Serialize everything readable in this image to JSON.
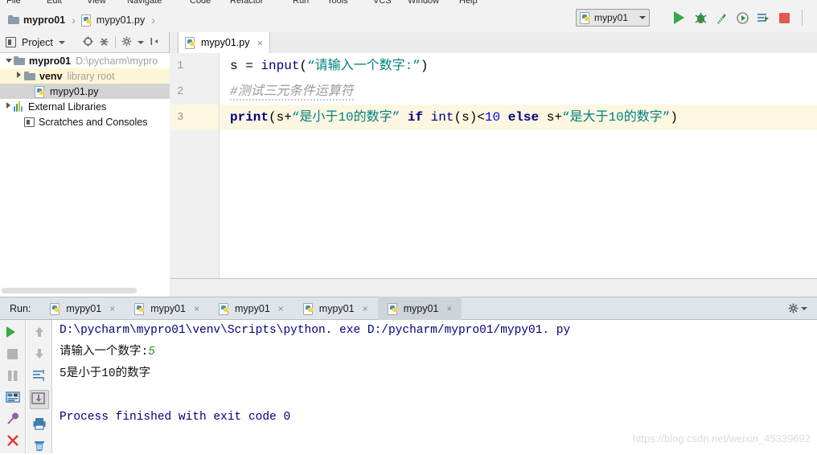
{
  "menubar": {
    "items": [
      "File",
      "Edit",
      "View",
      "Navigate",
      "Code",
      "Refactor",
      "Run",
      "Tools",
      "VCS",
      "Window",
      "Help"
    ]
  },
  "navbar": {
    "breadcrumbs": [
      {
        "label": "mypro01",
        "icon": "folder-icon",
        "bold": true
      },
      {
        "label": "mypy01.py",
        "icon": "python-file-icon",
        "bold": false
      }
    ],
    "separator": "›",
    "run_config": {
      "label": "mypy01",
      "icon": "python-config-icon"
    },
    "toolbar_icons": [
      {
        "name": "run-icon",
        "title": "Run"
      },
      {
        "name": "debug-icon",
        "title": "Debug"
      },
      {
        "name": "run-coverage-icon",
        "title": "Run with Coverage"
      },
      {
        "name": "profile-icon",
        "title": "Profile"
      },
      {
        "name": "run-with-console-icon",
        "title": "Run with Console"
      },
      {
        "name": "stop-icon",
        "title": "Stop"
      }
    ]
  },
  "project_panel": {
    "title": "Project",
    "toolbar_icons": [
      {
        "name": "locate-target-icon"
      },
      {
        "name": "collapse-all-icon"
      },
      {
        "name": "settings-gear-icon"
      },
      {
        "name": "hide-panel-icon"
      }
    ],
    "tree": [
      {
        "label": "mypro01",
        "detail": "D:\\pycharm\\mypro",
        "icon": "folder-icon",
        "expanded": true,
        "indent": 0,
        "bold": true,
        "selected": false
      },
      {
        "label": "venv",
        "detail": "library root",
        "icon": "folder-icon",
        "expanded": false,
        "indent": 1,
        "bold": true,
        "selected": "yellow"
      },
      {
        "label": "mypy01.py",
        "detail": "",
        "icon": "python-file-icon",
        "expanded": null,
        "indent": 2,
        "bold": false,
        "selected": "gray"
      },
      {
        "label": "External Libraries",
        "detail": "",
        "icon": "library-icon",
        "expanded": false,
        "indent": 0,
        "bold": false,
        "selected": false
      },
      {
        "label": "Scratches and Consoles",
        "detail": "",
        "icon": "scratches-icon",
        "expanded": null,
        "indent": 1,
        "bold": false,
        "selected": false
      }
    ]
  },
  "editor": {
    "tab": {
      "label": "mypy01.py",
      "icon": "python-file-icon",
      "close": "×"
    },
    "line_numbers": [
      "1",
      "2",
      "3"
    ],
    "highlighted_line": 3,
    "lines": [
      {
        "n": 1,
        "tokens": [
          {
            "t": "s = ",
            "c": "plain"
          },
          {
            "t": "input",
            "c": "fn"
          },
          {
            "t": "(",
            "c": "plain"
          },
          {
            "t": "“请输入一个数字:”",
            "c": "str"
          },
          {
            "t": ")",
            "c": "plain"
          }
        ]
      },
      {
        "n": 2,
        "tokens": [
          {
            "t": "#测试三元条件运算符",
            "c": "cmt"
          }
        ]
      },
      {
        "n": 3,
        "tokens": [
          {
            "t": "print",
            "c": "def"
          },
          {
            "t": "(s+",
            "c": "plain"
          },
          {
            "t": "“是小于10的数字”",
            "c": "str"
          },
          {
            "t": " ",
            "c": "plain"
          },
          {
            "t": "if",
            "c": "def"
          },
          {
            "t": " ",
            "c": "plain"
          },
          {
            "t": "int",
            "c": "fn"
          },
          {
            "t": "(s)<",
            "c": "plain"
          },
          {
            "t": "10",
            "c": "num"
          },
          {
            "t": " ",
            "c": "plain"
          },
          {
            "t": "else",
            "c": "def"
          },
          {
            "t": " s+",
            "c": "plain"
          },
          {
            "t": "“是大于10的数字”",
            "c": "str"
          },
          {
            "t": ")",
            "c": "plain"
          }
        ]
      }
    ]
  },
  "run_panel": {
    "label": "Run:",
    "tabs": [
      {
        "label": "mypy01",
        "active": false
      },
      {
        "label": "mypy01",
        "active": false
      },
      {
        "label": "mypy01",
        "active": false
      },
      {
        "label": "mypy01",
        "active": false
      },
      {
        "label": "mypy01",
        "active": true
      }
    ],
    "close_glyph": "×",
    "settings_icon": "gear-icon",
    "toolbar_col1": [
      {
        "name": "rerun-icon"
      },
      {
        "name": "stop-icon"
      },
      {
        "name": "pause-icon"
      },
      {
        "name": "console-view-icon"
      },
      {
        "name": "pin-tab-icon"
      },
      {
        "name": "close-icon"
      }
    ],
    "toolbar_col2": [
      {
        "name": "up-arrow-icon"
      },
      {
        "name": "down-arrow-icon"
      },
      {
        "name": "soft-wrap-icon"
      },
      {
        "name": "scroll-to-end-icon"
      },
      {
        "name": "print-icon"
      },
      {
        "name": "trash-icon"
      }
    ],
    "console_lines": [
      {
        "type": "command",
        "text": "D:\\pycharm\\mypro01\\venv\\Scripts\\python. exe D:/pycharm/mypro01/mypy01. py"
      },
      {
        "type": "prompt_input",
        "prompt": "请输入一个数字:",
        "input": "5"
      },
      {
        "type": "output",
        "text": "5是小于10的数字"
      },
      {
        "type": "blank",
        "text": ""
      },
      {
        "type": "finished",
        "text": "Process finished with exit code 0"
      }
    ]
  },
  "watermark": "https://blog.csdn.net/weixin_45339692",
  "colors": {
    "accent_green": "#39a845",
    "string_teal": "#008080",
    "keyword_navy": "#000080",
    "comment_gray": "#9a9a9a",
    "number_blue": "#0000ff",
    "highlight_line": "#fdf7e2",
    "panel_bg": "#f2f2f2",
    "runtab_bg": "#dfe3ea",
    "selection_gray": "#d4d4d4",
    "selection_yellow": "#fdf6d6"
  }
}
